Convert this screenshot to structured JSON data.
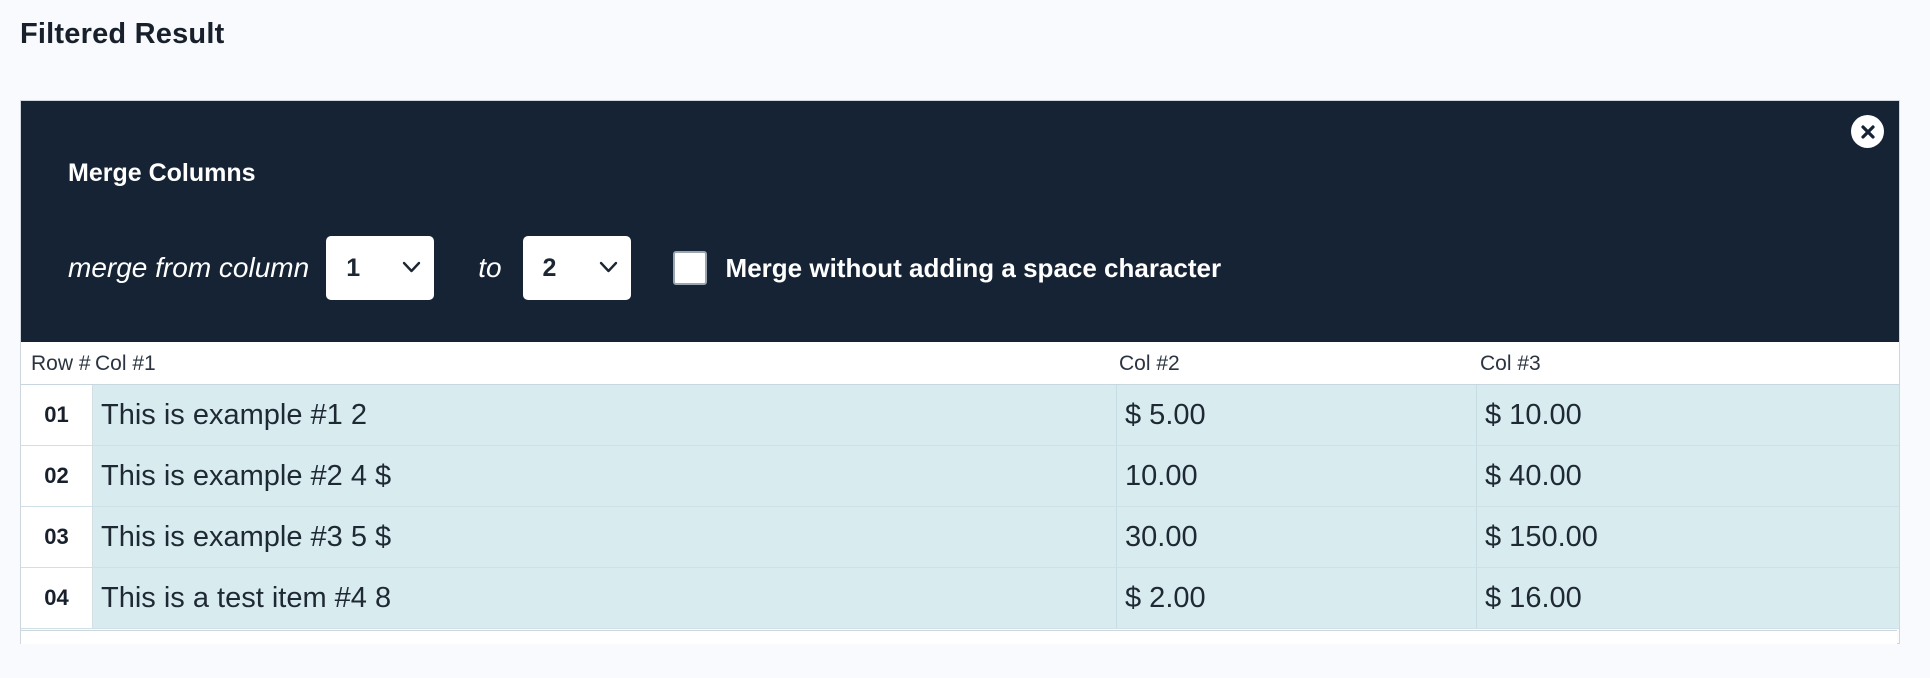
{
  "page": {
    "title": "Filtered Result"
  },
  "merge_panel": {
    "title": "Merge Columns",
    "from_label": "merge from column",
    "from_value": "1",
    "to_label": "to",
    "to_value": "2",
    "no_space_label": "Merge without adding a space character",
    "no_space_checked": false,
    "close_icon": "close-circle-icon"
  },
  "table": {
    "headers": [
      "Row #",
      "Col #1",
      "Col #2",
      "Col #3"
    ],
    "rows": [
      {
        "num": "01",
        "c1": "This is example #1 2",
        "c2": "$ 5.00",
        "c3": "$ 10.00"
      },
      {
        "num": "02",
        "c1": "This is example #2 4 $",
        "c2": "10.00",
        "c3": "$ 40.00"
      },
      {
        "num": "03",
        "c1": "This is example #3 5 $",
        "c2": "30.00",
        "c3": "$ 150.00"
      },
      {
        "num": "04",
        "c1": "This is a test item #4 8",
        "c2": "$ 2.00",
        "c3": "$ 16.00"
      }
    ]
  },
  "colors": {
    "panel_bg": "#152335",
    "row_bg": "#d8ebef",
    "page_bg": "#f8fafd"
  }
}
